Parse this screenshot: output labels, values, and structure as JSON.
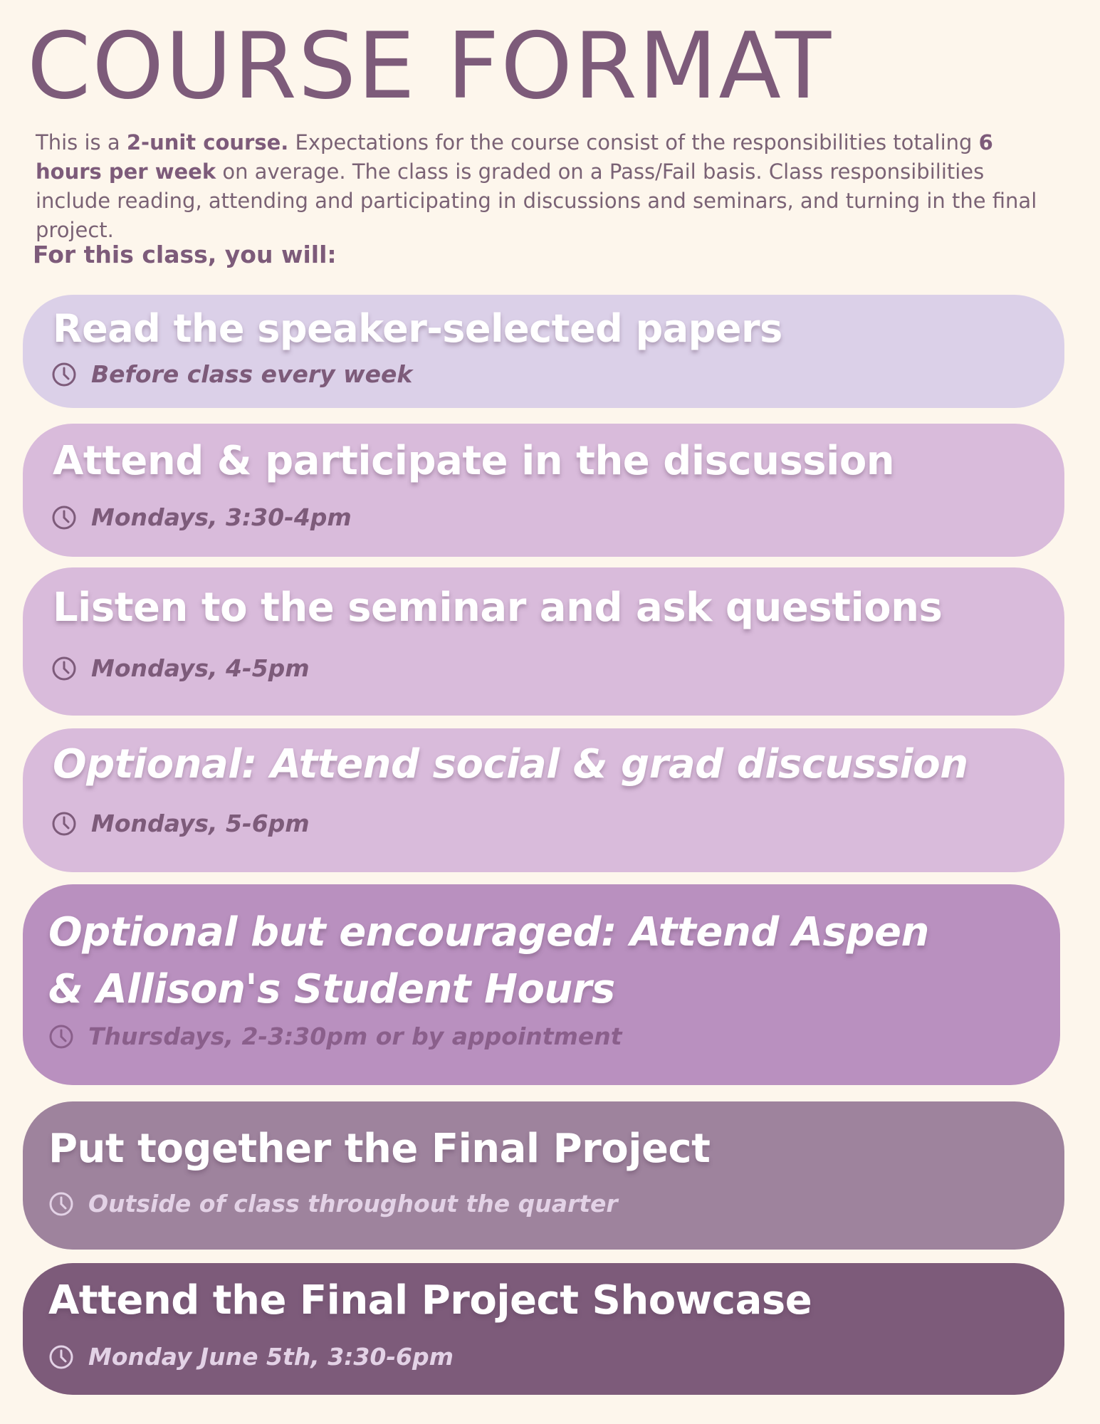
{
  "page": {
    "title": "COURSE FORMAT",
    "intro": {
      "t1": "This is a ",
      "b1": "2-unit course.",
      "t2": " Expectations for the course consist of the responsibilities totaling ",
      "b2": "6 hours per week",
      "t3": " on average. The class is graded on a Pass/Fail basis. Class responsibilities include reading, attending and participating in discussions and seminars, and turning in the final project."
    },
    "lead": "For this class, you will:"
  },
  "items": [
    {
      "heading": "Read the speaker-selected papers",
      "when": "Before class every week",
      "icon": "clock-icon",
      "bg": "#dbd0e8"
    },
    {
      "heading": "Attend & participate in the discussion",
      "when": "Mondays, 3:30-4pm",
      "icon": "clock-icon",
      "bg": "#d9bbdb"
    },
    {
      "heading": "Listen to the seminar and ask questions",
      "when": "Mondays, 4-5pm",
      "icon": "clock-icon",
      "bg": "#d9bbdb"
    },
    {
      "heading": "Optional: Attend social & grad discussion",
      "when": "Mondays, 5-6pm",
      "icon": "clock-icon",
      "bg": "#d9bbdb"
    },
    {
      "heading": "Optional but encouraged: Attend Aspen & Allison's Student Hours",
      "when": "Thursdays, 2-3:30pm or by appointment",
      "icon": "clock-icon",
      "bg": "#b990bf"
    },
    {
      "heading": "Put together the Final Project",
      "when": "Outside of class throughout the quarter",
      "icon": "clock-icon",
      "bg": "#9e839d"
    },
    {
      "heading": "Attend the Final Project Showcase",
      "when": "Monday June 5th, 3:30-6pm",
      "icon": "clock-icon",
      "bg": "#7d5b7a"
    }
  ],
  "colors": {
    "background": "#fdf6ec",
    "title": "#7d5b7a",
    "sub_dark": "#7d5b7a",
    "sub_light": "#e3d2e6"
  }
}
